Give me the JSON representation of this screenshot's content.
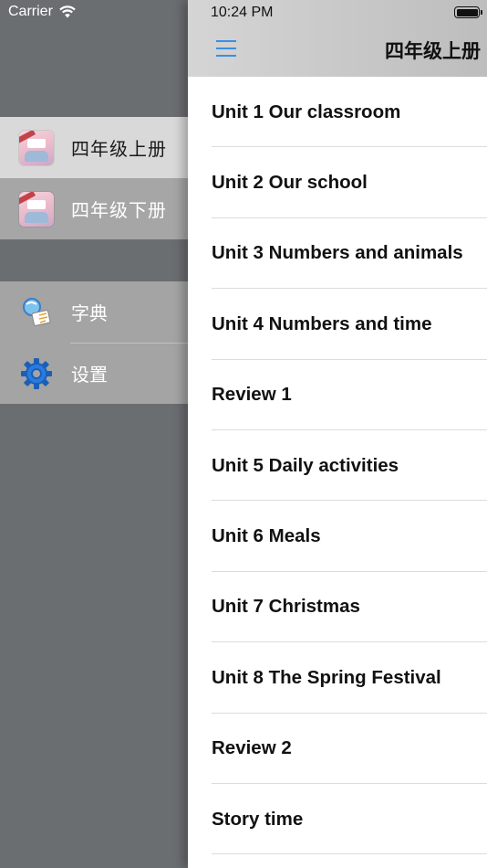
{
  "status_bar": {
    "carrier": "Carrier",
    "time": "10:24 PM"
  },
  "menu": {
    "grades": [
      {
        "label": "四年级上册",
        "selected": true
      },
      {
        "label": "四年级下册",
        "selected": false
      }
    ],
    "tools": [
      {
        "label": "字典",
        "icon": "dictionary-icon"
      },
      {
        "label": "设置",
        "icon": "gear-icon"
      }
    ]
  },
  "header": {
    "menu_icon": "hamburger-icon",
    "title": "四年级上册"
  },
  "units": [
    "Unit 1 Our classroom",
    "Unit 2 Our school",
    "Unit 3 Numbers and animals",
    "Unit 4 Numbers and time",
    "Review 1",
    "Unit 5 Daily activities",
    "Unit 6 Meals",
    "Unit 7 Christmas",
    "Unit 8 The Spring Festival",
    "Review 2",
    "Story time"
  ],
  "colors": {
    "accent": "#3b8ee3",
    "menu_background": "#6b6e71",
    "selected_row": "#d9d9d9"
  }
}
